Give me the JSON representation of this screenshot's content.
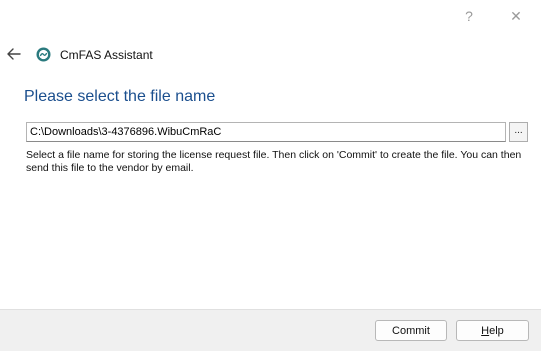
{
  "title_bar": {
    "help_glyph": "?",
    "close_glyph": "✕"
  },
  "header": {
    "back_icon": "arrow-left-icon",
    "logo_icon": "cmfas-logo-icon",
    "app_title": "CmFAS Assistant"
  },
  "main": {
    "heading": "Please select the file name",
    "file_path_value": "C:\\Downloads\\3-4376896.WibuCmRaC",
    "browse_label": "...",
    "description": "Select a file name for storing the license request file. Then click on 'Commit' to create the file. You can then send this file to the vendor by email."
  },
  "footer": {
    "commit_label": "Commit",
    "help_label_mnemonic": "H",
    "help_label_rest": "elp"
  },
  "colors": {
    "heading": "#1b4f8e",
    "logo": "#2a7a7e",
    "footer_bg": "#f0f0f0"
  }
}
